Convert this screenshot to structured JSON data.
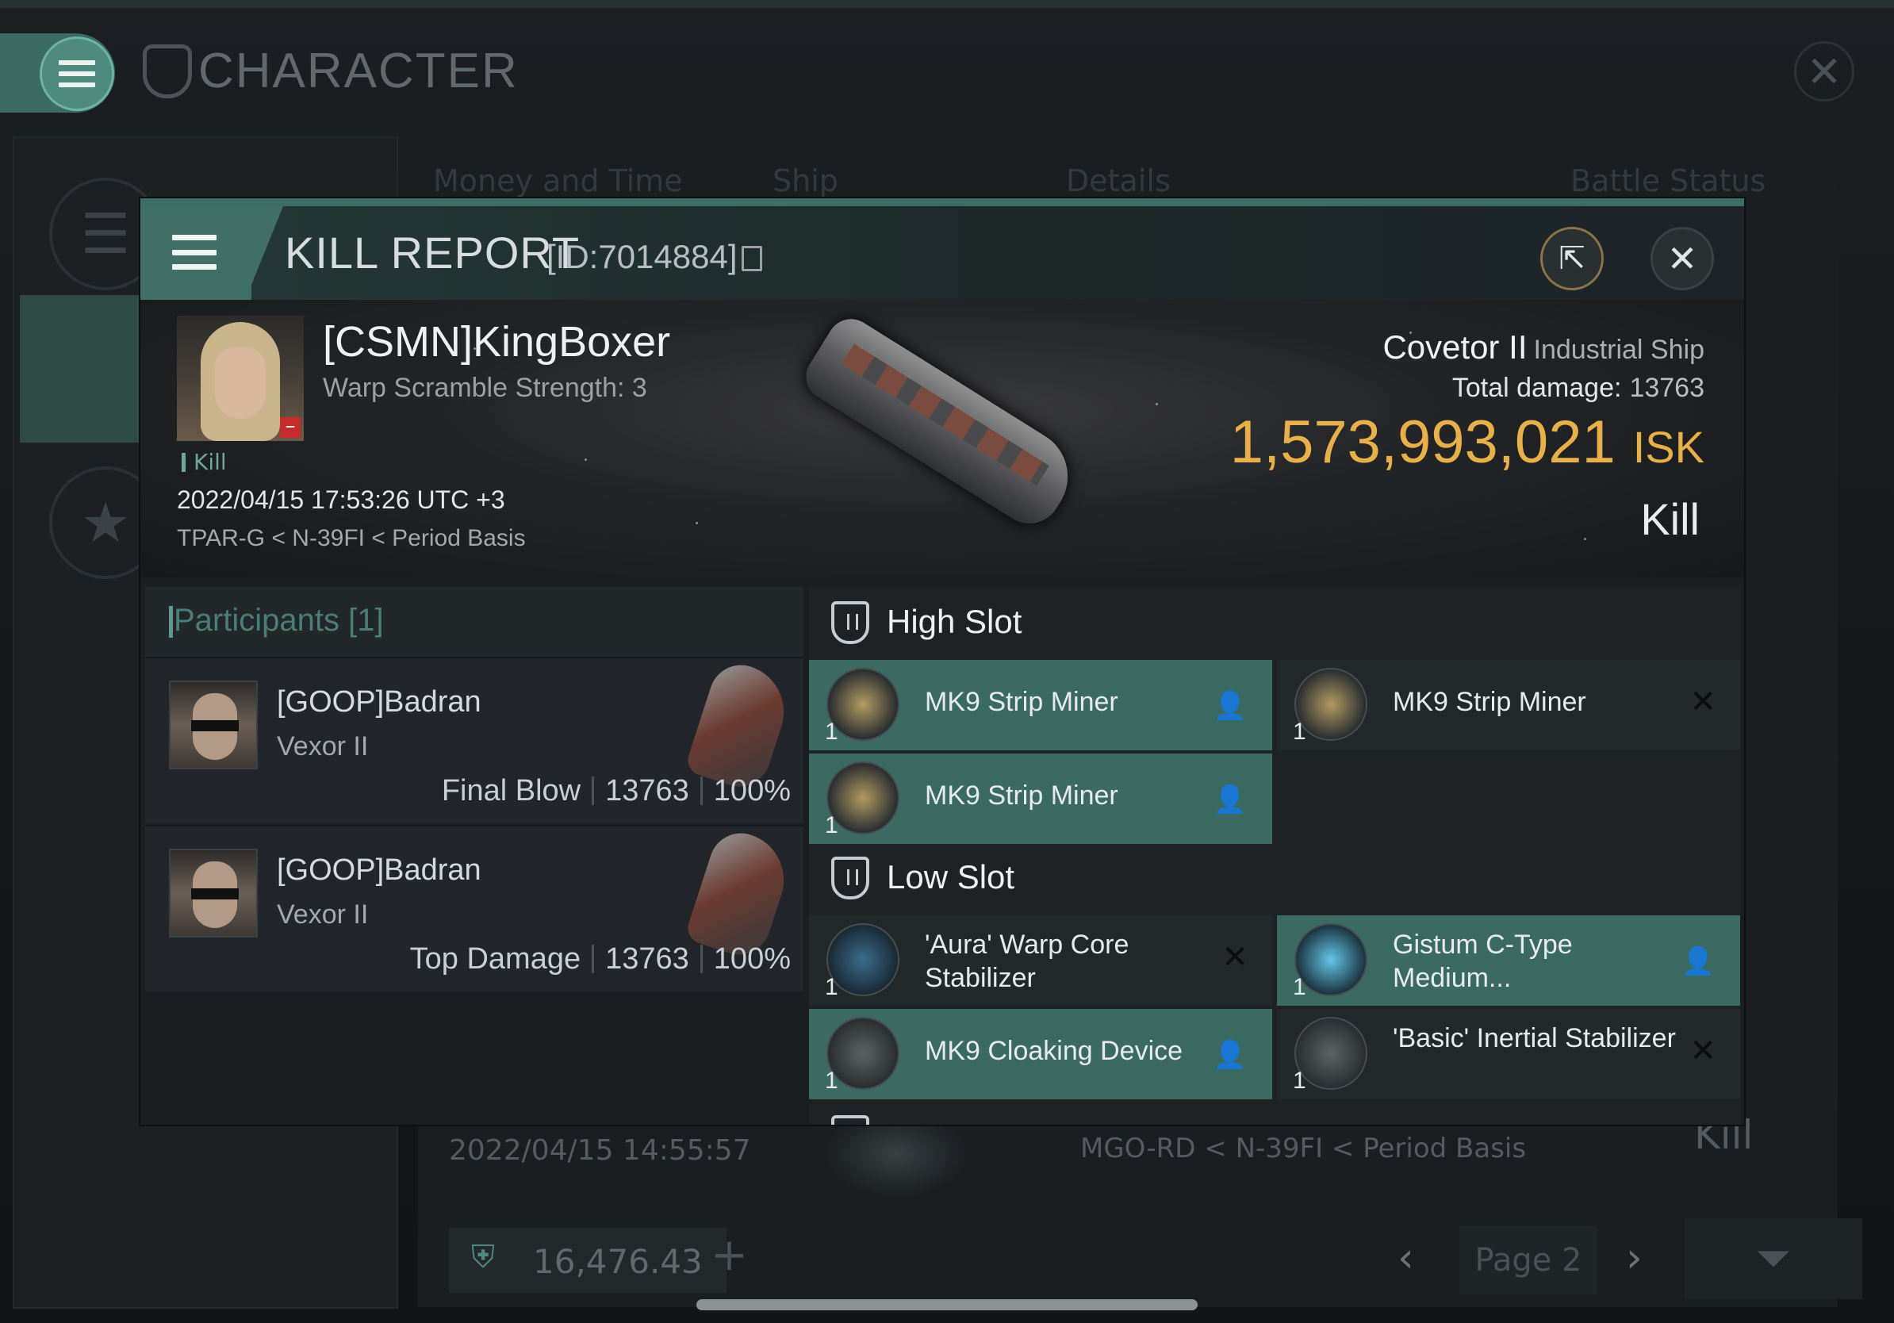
{
  "background": {
    "title": "CHARACTER",
    "columns": [
      "Money and Time",
      "Ship",
      "Details",
      "Battle Status"
    ],
    "row": {
      "date": "2022/04/15 14:55:57",
      "location": "MGO-RD < N-39FI < Period Basis",
      "type": "Kill"
    },
    "wallet": "16,476.43",
    "page": "Page 2"
  },
  "kill_report": {
    "title": "KILL REPORT",
    "id": "[ID:7014884]",
    "victim": {
      "name": "[CSMN]KingBoxer",
      "warp_scramble": "Warp Scramble Strength: 3",
      "tag": "Kill",
      "datetime": "2022/04/15 17:53:26 UTC +3",
      "location": "TPAR-G < N-39FI < Period Basis"
    },
    "ship": {
      "name": "Covetor II",
      "class": "Industrial Ship",
      "total_damage_label": "Total damage:",
      "total_damage": "13763",
      "isk_value": "1,573,993,021",
      "isk_unit": "ISK",
      "result": "Kill"
    },
    "participants": {
      "header": "Participants [1]",
      "items": [
        {
          "name": "[GOOP]Badran",
          "ship": "Vexor II",
          "role": "Final Blow",
          "damage": "13763",
          "percent": "100%"
        },
        {
          "name": "[GOOP]Badran",
          "ship": "Vexor II",
          "role": "Top Damage",
          "damage": "13763",
          "percent": "100%"
        }
      ]
    },
    "fitting": {
      "high_slot": {
        "label": "High Slot",
        "modules": [
          {
            "name": "MK9 Strip Miner",
            "qty": "1",
            "status": "fitted"
          },
          {
            "name": "MK9 Strip Miner",
            "qty": "1",
            "status": "destroyed"
          },
          {
            "name": "MK9 Strip Miner",
            "qty": "1",
            "status": "fitted"
          }
        ]
      },
      "low_slot": {
        "label": "Low Slot",
        "modules": [
          {
            "name": "'Aura' Warp Core Stabilizer",
            "qty": "1",
            "status": "destroyed"
          },
          {
            "name": "Gistum C-Type Medium...",
            "qty": "1",
            "status": "fitted"
          },
          {
            "name": "MK9 Cloaking Device",
            "qty": "1",
            "status": "fitted"
          },
          {
            "name": "'Basic' Inertial Stabilizer",
            "qty": "1",
            "status": "destroyed"
          }
        ]
      }
    }
  },
  "colors": {
    "accent": "#3f6f67",
    "isk": "#e8b04a",
    "dropped_module": "#3a6a62"
  }
}
